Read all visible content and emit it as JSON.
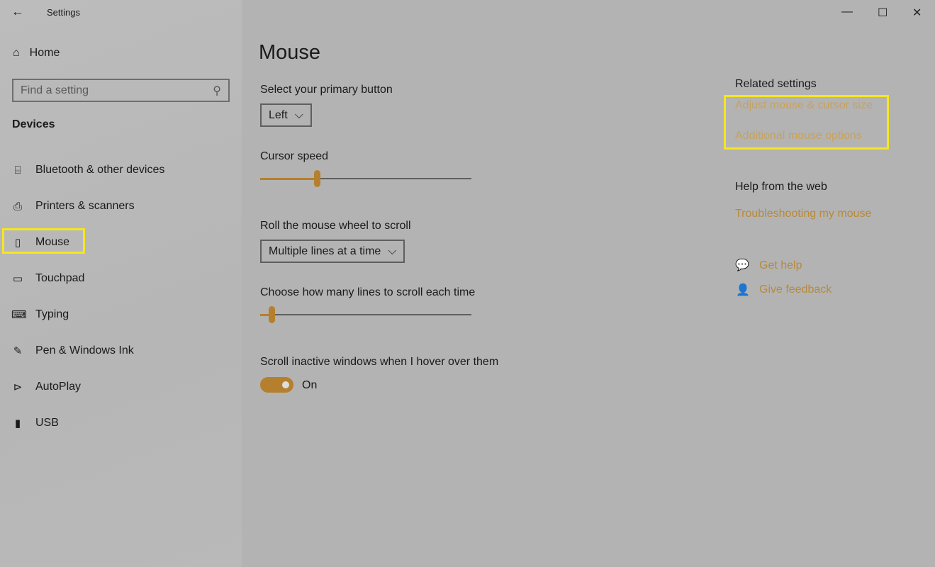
{
  "window": {
    "title": "Settings",
    "minimize": "—",
    "maximize": "☐",
    "close": "✕"
  },
  "sidebar": {
    "home": "Home",
    "search_placeholder": "Find a setting",
    "section": "Devices",
    "items": [
      {
        "label": "Bluetooth & other devices",
        "icon": "bluetooth-devices-icon"
      },
      {
        "label": "Printers & scanners",
        "icon": "printer-icon"
      },
      {
        "label": "Mouse",
        "icon": "mouse-icon",
        "selected": true
      },
      {
        "label": "Touchpad",
        "icon": "touchpad-icon"
      },
      {
        "label": "Typing",
        "icon": "keyboard-icon"
      },
      {
        "label": "Pen & Windows Ink",
        "icon": "pen-icon"
      },
      {
        "label": "AutoPlay",
        "icon": "autoplay-icon"
      },
      {
        "label": "USB",
        "icon": "usb-icon"
      }
    ]
  },
  "main": {
    "title": "Mouse",
    "primary_button": {
      "label": "Select your primary button",
      "value": "Left"
    },
    "cursor_speed": {
      "label": "Cursor speed",
      "value_percent": 27
    },
    "wheel_scroll": {
      "label": "Roll the mouse wheel to scroll",
      "value": "Multiple lines at a time"
    },
    "lines_scroll": {
      "label": "Choose how many lines to scroll each time",
      "value_percent": 5
    },
    "inactive_scroll": {
      "label": "Scroll inactive windows when I hover over them",
      "state": "On"
    }
  },
  "right": {
    "related_heading": "Related settings",
    "related_links": [
      "Adjust mouse & cursor size",
      "Additional mouse options"
    ],
    "help_heading": "Help from the web",
    "help_link": "Troubleshooting my mouse",
    "get_help": "Get help",
    "give_feedback": "Give feedback"
  },
  "colors": {
    "accent": "#b5802e",
    "highlight": "#f5e622",
    "link": "#b78a3c"
  }
}
